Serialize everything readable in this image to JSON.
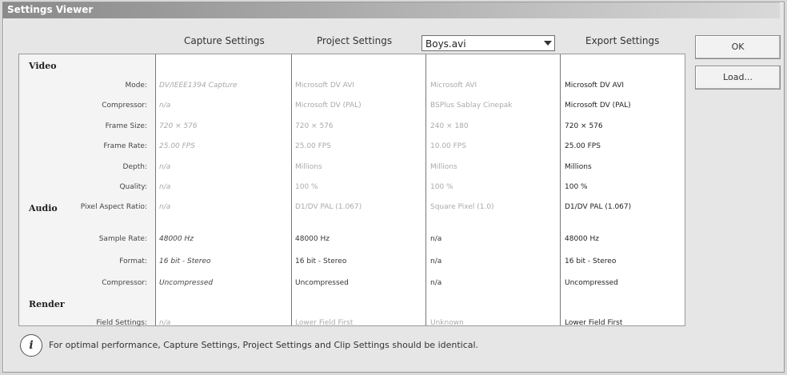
{
  "window": {
    "title": "Settings Viewer"
  },
  "header": {
    "capture": "Capture Settings",
    "project": "Project Settings",
    "clip_select": "Boys.avi",
    "export": "Export Settings"
  },
  "buttons": {
    "ok": "OK",
    "load": "Load..."
  },
  "sections": {
    "video": "Video",
    "audio": "Audio",
    "render": "Render"
  },
  "rows": [
    {
      "label": "Mode:",
      "capture": "DV/IEEE1394 Capture",
      "project": "Microsoft DV AVI",
      "clip": "Microsoft AVI",
      "export": "Microsoft DV AVI"
    },
    {
      "label": "Compressor:",
      "capture": "n/a",
      "project": "Microsoft DV (PAL)",
      "clip": "BSPlus Sablay Cinepak",
      "export": "Microsoft DV (PAL)"
    },
    {
      "label": "Frame Size:",
      "capture": "720 × 576",
      "project": "720 × 576",
      "clip": "240 × 180",
      "export": "720 × 576"
    },
    {
      "label": "Frame Rate:",
      "capture": "25.00 FPS",
      "project": "25.00 FPS",
      "clip": "10.00 FPS",
      "export": "25.00 FPS"
    },
    {
      "label": "Depth:",
      "capture": "n/a",
      "project": "Millions",
      "clip": "Millions",
      "export": "Millions"
    },
    {
      "label": "Quality:",
      "capture": "n/a",
      "project": "100 %",
      "clip": "100 %",
      "export": "100 %"
    },
    {
      "label": "Pixel Aspect Ratio:",
      "capture": "n/a",
      "project": "D1/DV PAL (1.067)",
      "clip": "Square Pixel (1.0)",
      "export": "D1/DV PAL (1.067)"
    },
    {
      "label": "Sample Rate:",
      "capture": "48000 Hz",
      "project": "48000 Hz",
      "clip": "n/a",
      "export": "48000 Hz"
    },
    {
      "label": "Format:",
      "capture": "16 bit - Stereo",
      "project": "16 bit - Stereo",
      "clip": "n/a",
      "export": "16 bit - Stereo"
    },
    {
      "label": "Compressor:",
      "capture": "Uncompressed",
      "project": "Uncompressed",
      "clip": "n/a",
      "export": "Uncompressed"
    },
    {
      "label": "Field Settings:",
      "capture": "n/a",
      "project": "Lower Field First",
      "clip": "Unknown",
      "export": "Lower Field First"
    }
  ],
  "info": {
    "icon": "info-icon",
    "text": "For optimal performance, Capture Settings, Project Settings and Clip Settings should be identical."
  }
}
